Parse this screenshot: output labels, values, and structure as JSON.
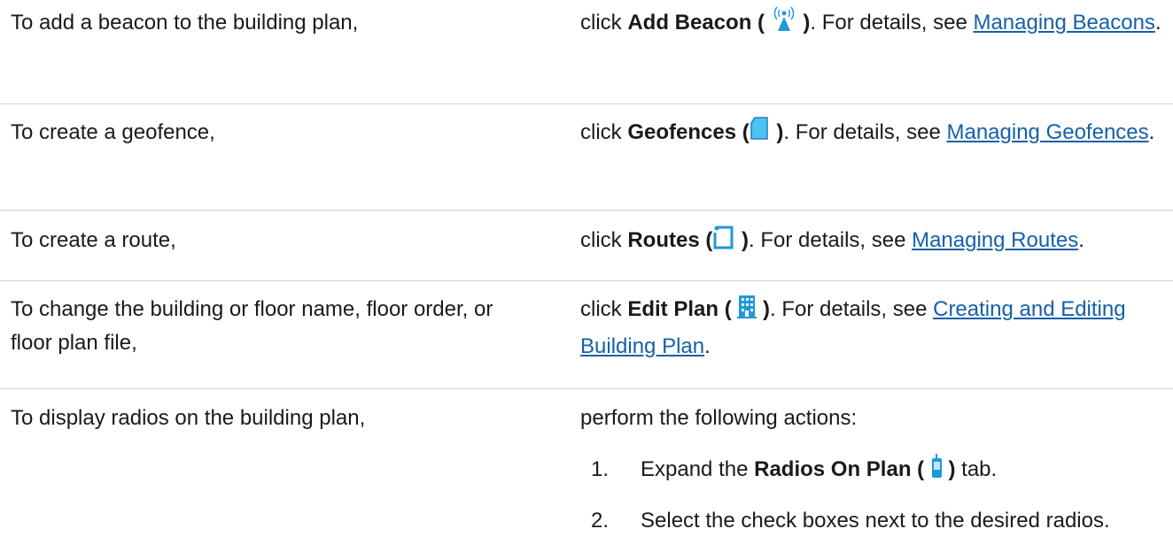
{
  "rows": [
    {
      "condition": "To add a beacon to the building plan,",
      "pre": "click ",
      "bold": "Add Beacon (",
      "bold_close": ")",
      "icon": "beacon-icon",
      "mid": ". For details, see ",
      "link": "Managing Beacons",
      "post": "."
    },
    {
      "condition": "To create a geofence,",
      "pre": "click ",
      "bold": "Geofences (",
      "bold_close": ")",
      "icon": "geofence-icon",
      "mid": ". For details, see ",
      "link": "Managing Geofences",
      "post": "."
    },
    {
      "condition": "To create a route,",
      "pre": "click ",
      "bold": "Routes (",
      "bold_close": ")",
      "icon": "route-icon",
      "mid": ". For details, see ",
      "link": "Managing Routes",
      "post": "."
    },
    {
      "condition": "To change the building or floor name, floor order, or floor plan file,",
      "pre": "click ",
      "bold": "Edit Plan (",
      "bold_close": ")",
      "icon": "building-icon",
      "mid": ". For details, see ",
      "link": "Creating and Editing Building Plan",
      "post": "."
    },
    {
      "condition": "To display radios on the building plan,",
      "intro": "perform the following actions:",
      "steps": [
        {
          "num": "1.",
          "pre": "Expand the ",
          "bold": "Radios On Plan (",
          "bold_close": ")",
          "icon": "radio-icon",
          "post": " tab."
        },
        {
          "num": "2.",
          "text": "Select the check boxes next to the desired radios."
        }
      ]
    }
  ],
  "colors": {
    "text": "#1a1a1a",
    "link": "#1560a8",
    "icon_blue": "#1e9ad6",
    "divider": "#d2d2d2"
  }
}
